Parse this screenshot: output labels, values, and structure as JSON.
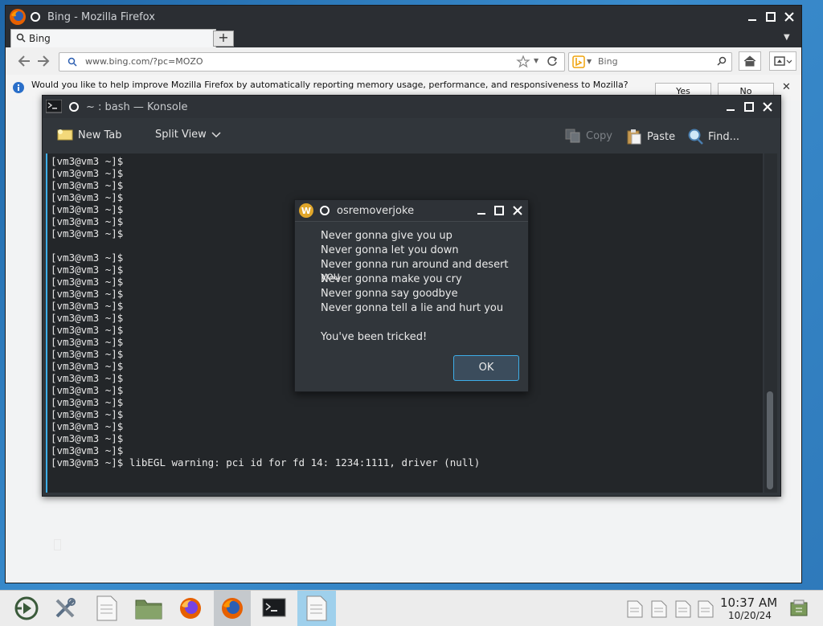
{
  "firefox": {
    "title": "Bing - Mozilla Firefox",
    "tab_label": "Bing",
    "new_tab": "+",
    "url": "www.bing.com/?pc=MOZO",
    "search_placeholder": "Bing",
    "infobar_text": "Would you like to help improve Mozilla Firefox by automatically reporting memory usage, performance, and responsiveness to Mozilla?",
    "yes_label": "Yes",
    "no_label": "No"
  },
  "konsole": {
    "title": "~ : bash — Konsole",
    "toolbar": {
      "new_tab": "New Tab",
      "split_view": "Split View",
      "copy": "Copy",
      "paste": "Paste",
      "find": "Find..."
    },
    "terminal_lines": [
      "[vm3@vm3 ~]$",
      "[vm3@vm3 ~]$",
      "[vm3@vm3 ~]$",
      "[vm3@vm3 ~]$",
      "[vm3@vm3 ~]$",
      "[vm3@vm3 ~]$",
      "[vm3@vm3 ~]$",
      "",
      "[vm3@vm3 ~]$",
      "[vm3@vm3 ~]$",
      "[vm3@vm3 ~]$",
      "[vm3@vm3 ~]$",
      "[vm3@vm3 ~]$",
      "[vm3@vm3 ~]$",
      "[vm3@vm3 ~]$",
      "[vm3@vm3 ~]$",
      "[vm3@vm3 ~]$",
      "[vm3@vm3 ~]$",
      "[vm3@vm3 ~]$",
      "[vm3@vm3 ~]$",
      "[vm3@vm3 ~]$",
      "[vm3@vm3 ~]$",
      "[vm3@vm3 ~]$",
      "[vm3@vm3 ~]$",
      "[vm3@vm3 ~]$",
      "[vm3@vm3 ~]$ libEGL warning: pci id for fd 14: 1234:1111, driver (null)"
    ]
  },
  "dialog": {
    "title": "osremoverjoke",
    "lines": [
      "Never gonna give you up",
      "Never gonna let you down",
      "Never gonna run around and desert you",
      "Never gonna make you cry",
      "Never gonna say goodbye",
      "Never gonna tell a lie and hurt you"
    ],
    "message": "You've been tricked!",
    "ok_label": "OK"
  },
  "taskbar": {
    "time": "10:37 AM",
    "date": "10/20/24"
  },
  "colors": {
    "accent": "#3daee9",
    "desktop": "#2e79ba",
    "terminal_bg": "#232629"
  }
}
